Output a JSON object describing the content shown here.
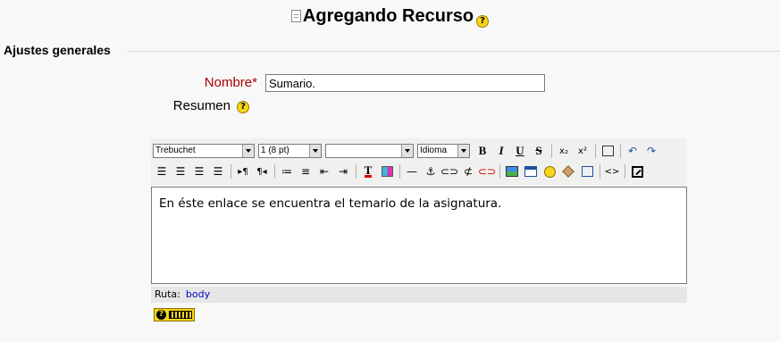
{
  "page": {
    "title": "Agregando Recurso",
    "title_icon": "document-icon",
    "help_icon": "help-icon"
  },
  "section": {
    "legend": "Ajustes generales"
  },
  "form": {
    "name_label": "Nombre",
    "name_required_mark": "*",
    "name_value": "Sumario.",
    "summary_label": "Resumen"
  },
  "editor": {
    "font_family": "Trebuchet",
    "font_size": "1 (8 pt)",
    "style": "",
    "language": "Idioma",
    "buttons": {
      "bold": "B",
      "italic": "I",
      "underline": "U",
      "strike": "S",
      "subscript": "x₂",
      "superscript": "x²",
      "undo": "↶",
      "redo": "↷",
      "ltr": "▸¶",
      "rtl": "¶◂",
      "hr": "—",
      "anchor": "⚓",
      "link": "⊂⊃",
      "unlink": "⊄",
      "nolink": "⊂⊃",
      "html": "<>"
    },
    "content": "En éste enlace se encuentra el temario de la asignatura.",
    "path_label": "Ruta:",
    "path_value": "body",
    "accent_colors": {
      "help_yellow": "#f7d61a",
      "required_red": "#aa0000",
      "link_blue": "#0000cc"
    }
  }
}
